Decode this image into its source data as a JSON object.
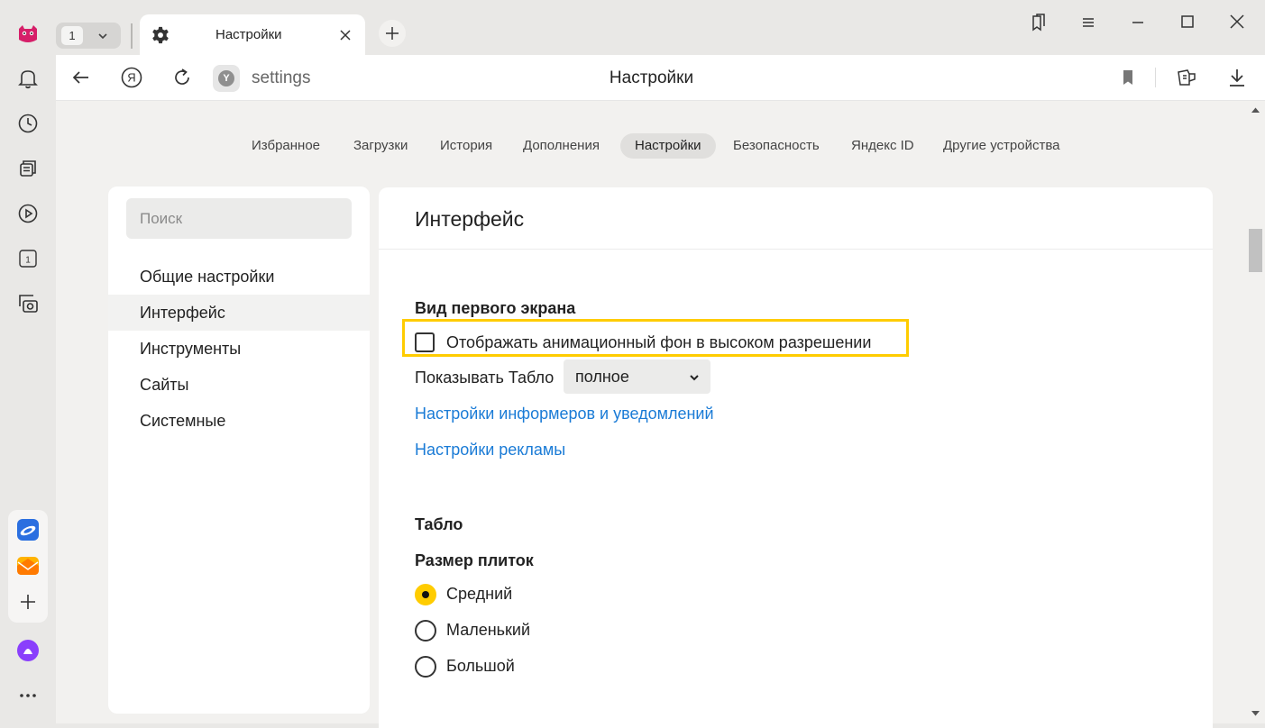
{
  "tabs_strip": {
    "tab_count": "1",
    "active_tab_title": "Настройки"
  },
  "address_bar": {
    "url_text": "settings",
    "page_title": "Настройки",
    "site_badge": "Y"
  },
  "top_nav": {
    "items": [
      "Избранное",
      "Загрузки",
      "История",
      "Дополнения",
      "Настройки",
      "Безопасность",
      "Яндекс ID",
      "Другие устройства"
    ],
    "active_index": 4
  },
  "left_panel": {
    "search_placeholder": "Поиск",
    "items": [
      "Общие настройки",
      "Интерфейс",
      "Инструменты",
      "Сайты",
      "Системные"
    ],
    "active_index": 1
  },
  "main": {
    "title": "Интерфейс",
    "first_screen": {
      "heading": "Вид первого экрана",
      "checkbox_label": "Отображать анимационный фон в высоком разрешении",
      "checkbox_checked": false,
      "show_tablo_label": "Показывать Табло",
      "show_tablo_value": "полное",
      "link_informers": "Настройки информеров и уведомлений",
      "link_ads": "Настройки рекламы"
    },
    "tablo": {
      "heading": "Табло",
      "tile_size_heading": "Размер плиток",
      "options": [
        "Средний",
        "Маленький",
        "Большой"
      ],
      "selected_index": 0
    }
  },
  "colors": {
    "accent_yellow": "#ffcc00",
    "link_blue": "#1a7bd6",
    "alice_purple": "#8a3ffc"
  },
  "sidebar_icons": [
    "yandex-logo-icon",
    "bell-icon",
    "clock-icon",
    "collections-icon",
    "play-icon",
    "tab-number-icon",
    "screenshot-icon",
    "yandex-disk-icon",
    "mail-icon",
    "plus-icon",
    "alice-icon",
    "more-icon"
  ]
}
